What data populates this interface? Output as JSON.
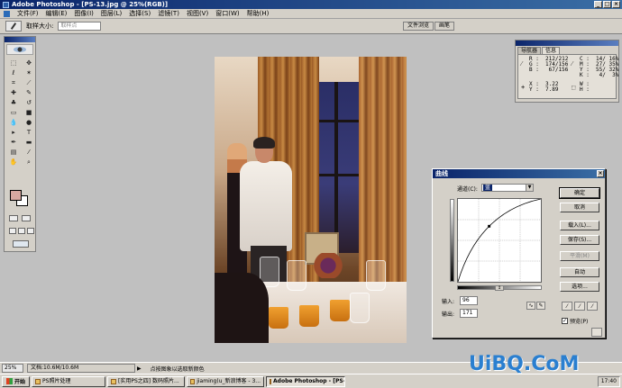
{
  "titlebar": {
    "title": "Adobe Photoshop - [PS-13.jpg @ 25%(RGB)]"
  },
  "menu": [
    "文件(F)",
    "编辑(E)",
    "图像(I)",
    "图层(L)",
    "选择(S)",
    "滤镜(T)",
    "视图(V)",
    "窗口(W)",
    "帮助(H)"
  ],
  "options": {
    "sample_label": "取样大小:",
    "sample_value": "取样点"
  },
  "palette_well": [
    "文件浏览",
    "画笔"
  ],
  "info_panel": {
    "tabs": [
      "导航器",
      "信息"
    ],
    "r": "R :  212/212",
    "g": "G :  174/156",
    "b": "B :   67/156",
    "c": "C :  14/ 16%",
    "m": "M :  27/ 35%",
    "y": "Y :  55/ 32%",
    "k": "K :   4/  3%",
    "x": "X :  3.22",
    "yy": "Y :  7.89",
    "w": "W :",
    "h": "H :"
  },
  "curves": {
    "title": "曲线",
    "channel_label": "通道(C):",
    "channel_value": "蓝",
    "input_label": "输入:",
    "input_value": "96",
    "output_label": "输出:",
    "output_value": "171",
    "buttons": {
      "ok": "确定",
      "cancel": "取消",
      "load": "载入(L)...",
      "save": "保存(S)...",
      "smooth": "平滑(M)",
      "auto": "自动",
      "options": "选项..."
    },
    "preview_label": "预览(P)",
    "point": {
      "input": 96,
      "output": 171
    }
  },
  "status": {
    "zoom": "25%",
    "doc": "文档:10.6M/10.6M",
    "hint": "点按图象以选取新颜色"
  },
  "watermark": "UiBQ.CoM",
  "taskbar": {
    "start": "开始",
    "items": [
      "PS照片处理",
      "[实用PS之四] 数码照片...",
      "jiaming(u_新浪博客 - 3...",
      "Adobe Photoshop - [PS-..."
    ],
    "clock": "17:40"
  },
  "colors": {
    "foreground": "#d8a8a0",
    "background": "#ffffff",
    "titlebar": "#0a246a"
  }
}
